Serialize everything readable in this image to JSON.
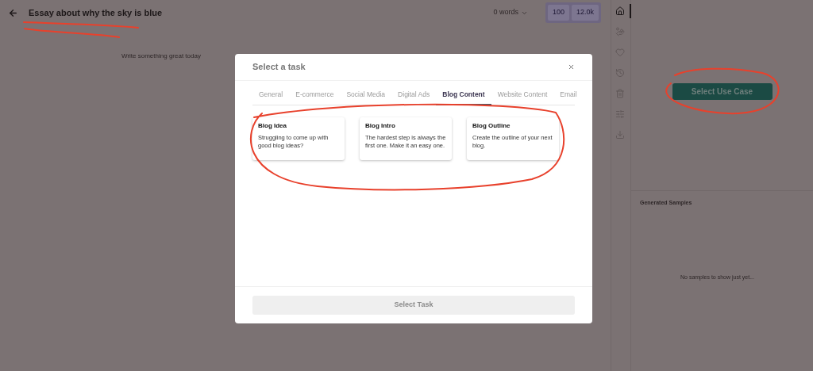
{
  "header": {
    "title": "Essay about why the sky is blue",
    "word_count": "0 words",
    "credits": [
      "100",
      "12.0k"
    ]
  },
  "editor": {
    "placeholder": "Write something great today"
  },
  "rail": [
    {
      "selected": true
    },
    {
      "selected": false
    },
    {
      "selected": false
    },
    {
      "selected": false
    },
    {
      "selected": false
    },
    {
      "selected": false
    },
    {
      "selected": false
    }
  ],
  "right_panel": {
    "button": "Select Use Case",
    "samples_title": "Generated Samples",
    "empty_text": "No samples to show just yet..."
  },
  "modal": {
    "title": "Select a task",
    "tabs": [
      {
        "label": "General",
        "selected": false
      },
      {
        "label": "E-commerce",
        "selected": false
      },
      {
        "label": "Social Media",
        "selected": false
      },
      {
        "label": "Digital Ads",
        "selected": false
      },
      {
        "label": "Blog Content",
        "selected": true
      },
      {
        "label": "Website Content",
        "selected": false
      },
      {
        "label": "Email",
        "selected": false
      }
    ],
    "cards": [
      {
        "title": "Blog Idea",
        "description": "Struggling to come up with good blog ideas?"
      },
      {
        "title": "Blog Intro",
        "description": "The hardest step is always the first one. Make it an easy one."
      },
      {
        "title": "Blog Outline",
        "description": "Create the outline of your next blog."
      }
    ],
    "button": {
      "label": "Select Task",
      "disabled": true
    }
  }
}
